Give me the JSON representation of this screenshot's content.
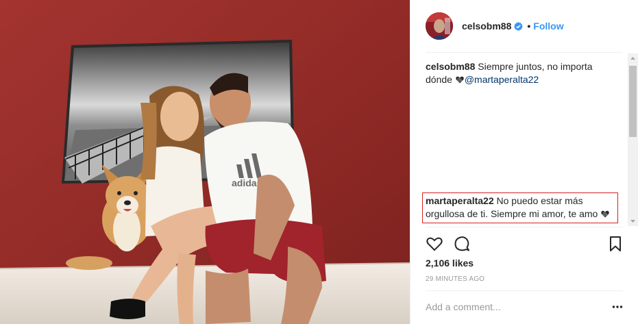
{
  "header": {
    "username": "celsobm88",
    "separator": "•",
    "follow_label": "Follow"
  },
  "caption": {
    "username": "celsobm88",
    "text": "Siempre juntos, no importa dónde",
    "mention": "@martaperalta22"
  },
  "highlighted_comment": {
    "username": "martaperalta22",
    "text": "No puedo estar más orgullosa de ti. Siempre mi amor, te amo"
  },
  "post": {
    "likes": "2,106 likes",
    "timestamp": "29 MINUTES AGO"
  },
  "add_comment": {
    "placeholder": "Add a comment..."
  },
  "icons": {
    "like": "heart-icon",
    "comment": "comment-icon",
    "save": "bookmark-icon",
    "more": "more-options-icon",
    "verified": "verified-badge-icon"
  },
  "colors": {
    "accent": "#3897f0",
    "highlight_border": "#d62121",
    "mention": "#003569",
    "wall": "#9a2e2a"
  }
}
